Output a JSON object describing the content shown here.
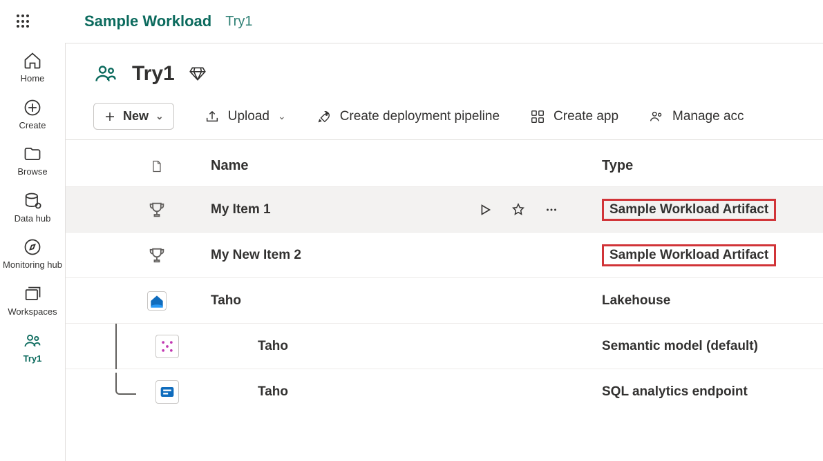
{
  "breadcrumb": {
    "root": "Sample Workload",
    "current": "Try1"
  },
  "nav": {
    "home": "Home",
    "create": "Create",
    "browse": "Browse",
    "datahub": "Data hub",
    "monitoring": "Monitoring hub",
    "workspaces": "Workspaces",
    "current": "Try1"
  },
  "workspace": {
    "title": "Try1"
  },
  "toolbar": {
    "new": "New",
    "upload": "Upload",
    "pipeline": "Create deployment pipeline",
    "createapp": "Create app",
    "manage": "Manage acc"
  },
  "columns": {
    "name": "Name",
    "type": "Type"
  },
  "items": [
    {
      "name": "My Item 1",
      "type": "Sample Workload Artifact",
      "highlight": true,
      "hovered": true,
      "icon": "trophy"
    },
    {
      "name": "My New Item 2",
      "type": "Sample Workload Artifact",
      "highlight": true,
      "icon": "trophy"
    },
    {
      "name": "Taho",
      "type": "Lakehouse",
      "icon": "lakehouse"
    }
  ],
  "children": [
    {
      "name": "Taho",
      "type": "Semantic model (default)",
      "icon": "semantic"
    },
    {
      "name": "Taho",
      "type": "SQL analytics endpoint",
      "icon": "sql"
    }
  ]
}
